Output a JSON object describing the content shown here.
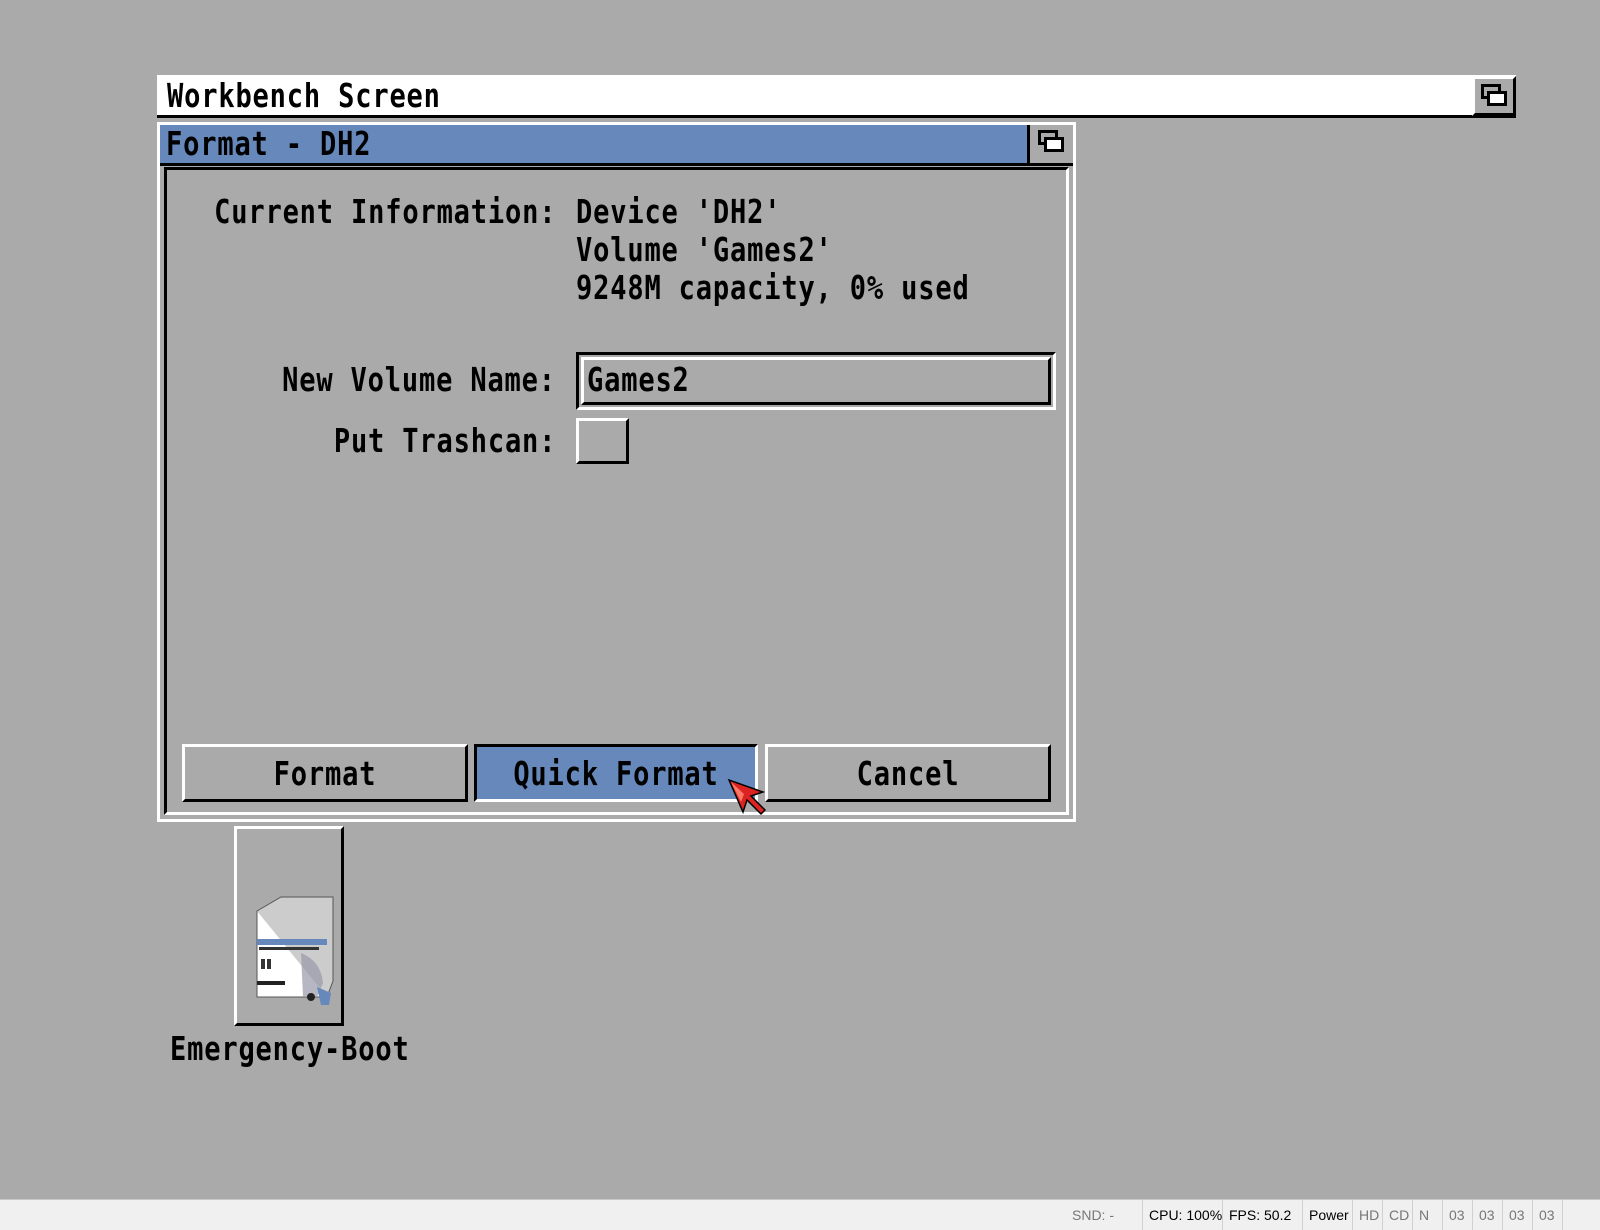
{
  "screen": {
    "title": "Workbench Screen"
  },
  "window": {
    "title": "Format - DH2",
    "current_info_label": "Current Information:",
    "device_line": "Device 'DH2'",
    "volume_line": "Volume 'Games2'",
    "capacity_line": "9248M capacity, 0% used",
    "new_volume_label": "New Volume Name:",
    "new_volume_value": "Games2",
    "trashcan_label": "Put Trashcan:",
    "trashcan_checked": false,
    "buttons": {
      "format": "Format",
      "quick_format": "Quick Format",
      "cancel": "Cancel"
    }
  },
  "desktop": {
    "icon_label": "Emergency-Boot",
    "icon": "hard-drive-icon"
  },
  "statusbar": {
    "snd": "SND: -",
    "cpu": "CPU: 100%",
    "fps": "FPS: 50.2",
    "power": "Power",
    "hd": "HD",
    "cd": "CD",
    "n": "N",
    "df0": "03",
    "df1": "03",
    "df2": "03",
    "df3": "03"
  },
  "colors": {
    "background": "#aaaaaa",
    "accent": "#6688bb",
    "pointer": "#dd2222"
  }
}
